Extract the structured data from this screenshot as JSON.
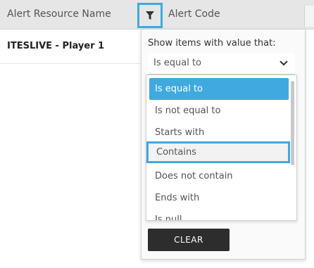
{
  "grid": {
    "columns": [
      "Alert Resource Name",
      "Alert Code"
    ],
    "rows": [
      {
        "resource_name": "ITESLIVE - Player 1"
      }
    ]
  },
  "filter_popup": {
    "label": "Show items with value that:",
    "selected_operator": "Is equal to",
    "options": [
      "Is equal to",
      "Is not equal to",
      "Starts with",
      "Contains",
      "Does not contain",
      "Ends with",
      "Is null"
    ],
    "highlighted_option": "Contains",
    "clear_label": "CLEAR"
  },
  "colors": {
    "accent": "#3fa9e0",
    "header_bg": "#e6e6e6",
    "dark_button": "#2d2d2d"
  },
  "icons": {
    "filter": "filter-funnel-icon",
    "dropdown": "chevron-down-icon"
  }
}
